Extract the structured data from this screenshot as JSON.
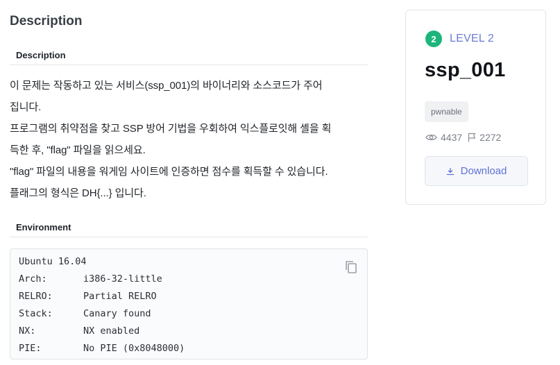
{
  "main": {
    "section_title": "Description",
    "description_heading": "Description",
    "description_lines": [
      "이 문제는 작동하고 있는 서비스(ssp_001)의 바이너리와 소스코드가 주어",
      "집니다.",
      "프로그램의 취약점을 찾고 SSP 방어 기법을 우회하여 익스플로잇해 셸을 획",
      "득한 후, \"flag\" 파일을 읽으세요.",
      "\"flag\" 파일의 내용을 워게임 사이트에 인증하면 점수를 획득할 수 있습니다.",
      "플래그의 형식은 DH{...} 입니다."
    ],
    "environment_heading": "Environment",
    "environment": [
      {
        "key": "Ubuntu 16.04",
        "value": ""
      },
      {
        "key": "Arch:",
        "value": "i386-32-little"
      },
      {
        "key": "RELRO:",
        "value": "Partial RELRO"
      },
      {
        "key": "Stack:",
        "value": "Canary found"
      },
      {
        "key": "NX:",
        "value": "NX enabled"
      },
      {
        "key": "PIE:",
        "value": "No PIE (0x8048000)"
      }
    ],
    "copy_icon": "copy-icon"
  },
  "card": {
    "level_number": "2",
    "level_label": "LEVEL 2",
    "title": "ssp_001",
    "tag": "pwnable",
    "views": "4437",
    "solves": "2272",
    "download_label": "Download",
    "icons": [
      "eye-icon",
      "flag-icon",
      "download-icon"
    ]
  },
  "colors": {
    "level_badge": "#1db57b",
    "level_text": "#6b7bd6",
    "download_text": "#5c72d4"
  }
}
